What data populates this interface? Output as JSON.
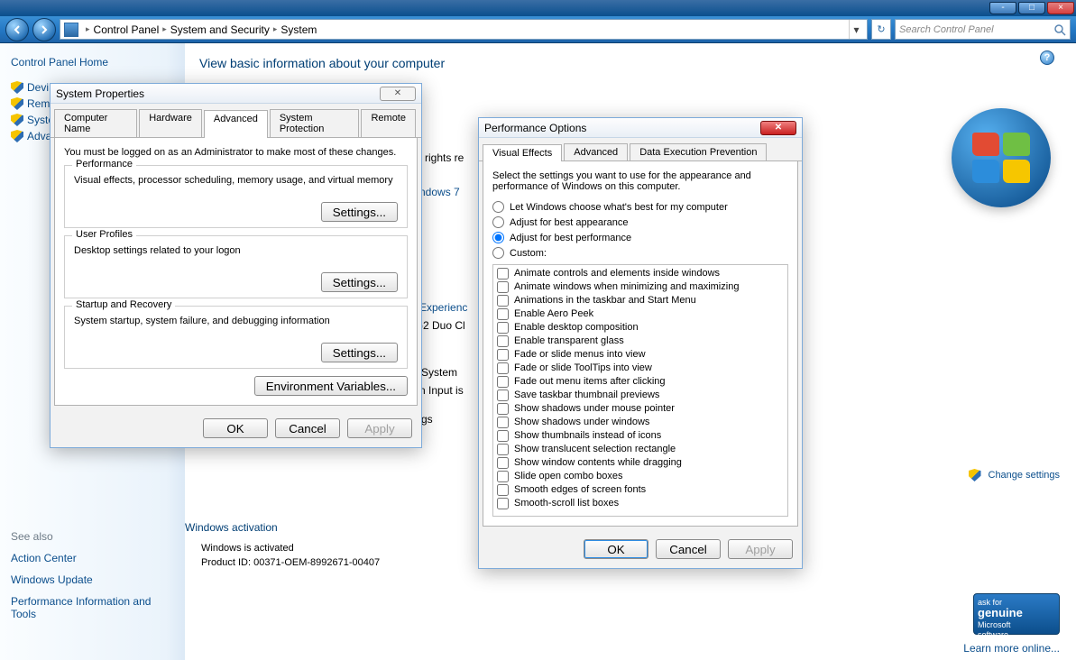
{
  "titlebar": {
    "min": "_",
    "max": "□",
    "close": "×"
  },
  "breadcrumb": {
    "items": [
      "Control Panel",
      "System and Security",
      "System"
    ],
    "search_placeholder": "Search Control Panel"
  },
  "sidebar": {
    "home": "Control Panel Home",
    "items": [
      "Devi",
      "Remi",
      "Syste",
      "Adva"
    ],
    "see_also_label": "See also",
    "see_also": [
      "Action Center",
      "Windows Update",
      "Performance Information and Tools"
    ]
  },
  "content": {
    "heading": "View basic information about your computer",
    "rights": "l rights re",
    "edition_link": "ndows 7",
    "peek1": "Experienc",
    "peek2": ")2 Duo Cl",
    "peek3": "System",
    "peek4": "n Input is",
    "peek5": "gs",
    "activation_heading": "Windows activation",
    "activation_line1": "Windows is activated",
    "activation_line2": "Product ID: 00371-OEM-8992671-00407",
    "change_settings": "Change settings",
    "genuine_line1": "ask for",
    "genuine_line2": "genuine",
    "genuine_line3": "Microsoft",
    "genuine_line4": "software",
    "learn_more": "Learn more online..."
  },
  "sysprops": {
    "title": "System Properties",
    "tabs": [
      "Computer Name",
      "Hardware",
      "Advanced",
      "System Protection",
      "Remote"
    ],
    "admin_note": "You must be logged on as an Administrator to make most of these changes.",
    "perf_legend": "Performance",
    "perf_desc": "Visual effects, processor scheduling, memory usage, and virtual memory",
    "user_legend": "User Profiles",
    "user_desc": "Desktop settings related to your logon",
    "startup_legend": "Startup and Recovery",
    "startup_desc": "System startup, system failure, and debugging information",
    "settings_btn": "Settings...",
    "env_btn": "Environment Variables...",
    "ok": "OK",
    "cancel": "Cancel",
    "apply": "Apply"
  },
  "perfopts": {
    "title": "Performance Options",
    "tabs": [
      "Visual Effects",
      "Advanced",
      "Data Execution Prevention"
    ],
    "intro": "Select the settings you want to use for the appearance and performance of Windows on this computer.",
    "radio_auto": "Let Windows choose what's best for my computer",
    "radio_appearance": "Adjust for best appearance",
    "radio_performance": "Adjust for best performance",
    "radio_custom": "Custom:",
    "checks": [
      "Animate controls and elements inside windows",
      "Animate windows when minimizing and maximizing",
      "Animations in the taskbar and Start Menu",
      "Enable Aero Peek",
      "Enable desktop composition",
      "Enable transparent glass",
      "Fade or slide menus into view",
      "Fade or slide ToolTips into view",
      "Fade out menu items after clicking",
      "Save taskbar thumbnail previews",
      "Show shadows under mouse pointer",
      "Show shadows under windows",
      "Show thumbnails instead of icons",
      "Show translucent selection rectangle",
      "Show window contents while dragging",
      "Slide open combo boxes",
      "Smooth edges of screen fonts",
      "Smooth-scroll list boxes"
    ],
    "ok": "OK",
    "cancel": "Cancel",
    "apply": "Apply"
  }
}
